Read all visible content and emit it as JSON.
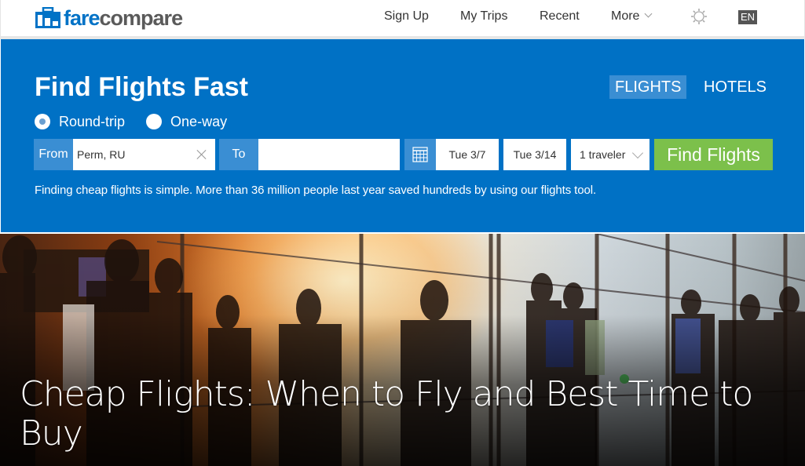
{
  "header": {
    "logo": {
      "part1": "fare",
      "part2": "compare",
      "icon": "suitcase-icon"
    },
    "nav": [
      {
        "label": "Sign Up"
      },
      {
        "label": "My Trips"
      },
      {
        "label": "Recent"
      },
      {
        "label": "More",
        "icon": "chevron-down-icon"
      }
    ],
    "settings_icon": "gear-icon",
    "language": "EN"
  },
  "search": {
    "title": "Find Flights Fast",
    "tabs": [
      {
        "label": "FLIGHTS",
        "active": true
      },
      {
        "label": "HOTELS",
        "active": false
      }
    ],
    "trip_types": [
      {
        "label": "Round-trip",
        "checked": true
      },
      {
        "label": "One-way",
        "checked": false
      }
    ],
    "from": {
      "label": "From",
      "value": "Perm, RU",
      "placeholder": ""
    },
    "to": {
      "label": "To",
      "value": "",
      "placeholder": ""
    },
    "calendar_icon": "calendar-icon",
    "depart_date": "Tue 3/7",
    "return_date": "Tue 3/14",
    "travelers": "1 traveler",
    "submit_label": "Find Flights",
    "tagline": "Finding cheap flights is simple. More than 36 million people last year saved hundreds by using our flights tool.",
    "colors": {
      "panel": "#0071c5",
      "label_bg": "#3a8ed3",
      "submit": "#7cc04b"
    }
  },
  "hero": {
    "title": "Cheap Flights: When to Fly and Best Time to Buy",
    "image_alt": "Travelers walking through airport terminal at sunset"
  }
}
